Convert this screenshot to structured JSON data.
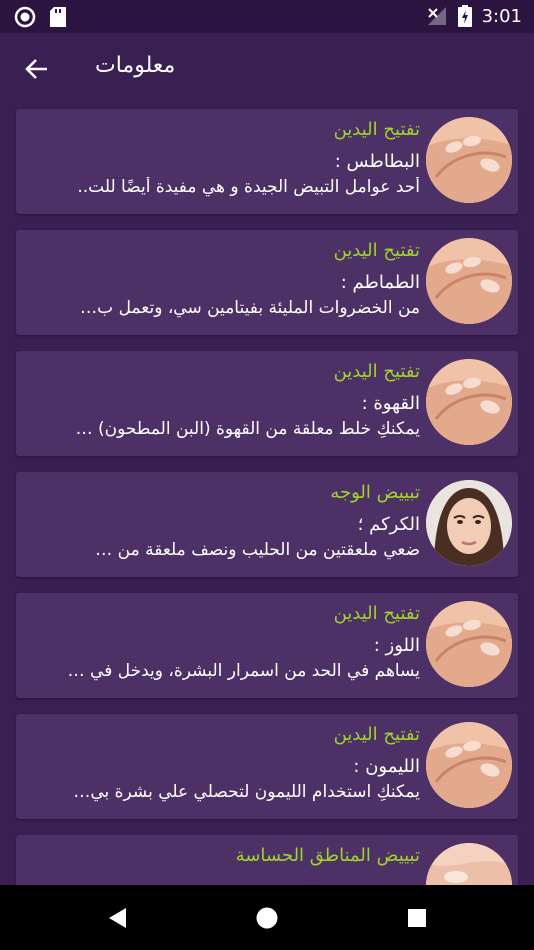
{
  "status_bar": {
    "time": "3:01"
  },
  "app_bar": {
    "title": "معلومات"
  },
  "items": [
    {
      "category": "تفتيح اليدين",
      "name": "البطاطس :",
      "description": "أحد عوامل التبيض الجيدة و هي مفيدة أيضًا للت..",
      "image": "hands-image"
    },
    {
      "category": "تفتيح اليدين",
      "name": "الطماطم :",
      "description": "من الخضروات المليئة بفيتامين سي، وتعمل ب…",
      "image": "hands-image"
    },
    {
      "category": "تفتيح اليدين",
      "name": "القهوة :",
      "description": "يمكنكِ خلط معلقة من القهوة (البن المطحون) …",
      "image": "hands-image"
    },
    {
      "category": "تبييض الوجه",
      "name": "الكركم ؛",
      "description": "ضعي ملعقتين من الحليب ونصف ملعقة من …",
      "image": "face-image"
    },
    {
      "category": "تفتيح اليدين",
      "name": "اللوز :",
      "description": "يساهم في الحد من اسمرار البشرة، ويدخل في …",
      "image": "hands-image"
    },
    {
      "category": "تفتيح اليدين",
      "name": "الليمون :",
      "description": "يمكنكِ استخدام الليمون لتحصلي علي بشرة بي…",
      "image": "hands-image"
    },
    {
      "category": "تبييض المناطق الحساسة",
      "name": "",
      "description": "",
      "image": "body-image"
    }
  ],
  "colors": {
    "background": "#3a1f52",
    "card": "#4d3166",
    "category_text": "#9fd32a",
    "text": "#ffffff",
    "status_bar": "#2b1540",
    "nav_bar": "#000000"
  },
  "nav_bar": [
    "back-triangle-icon",
    "home-circle-icon",
    "recents-square-icon"
  ]
}
